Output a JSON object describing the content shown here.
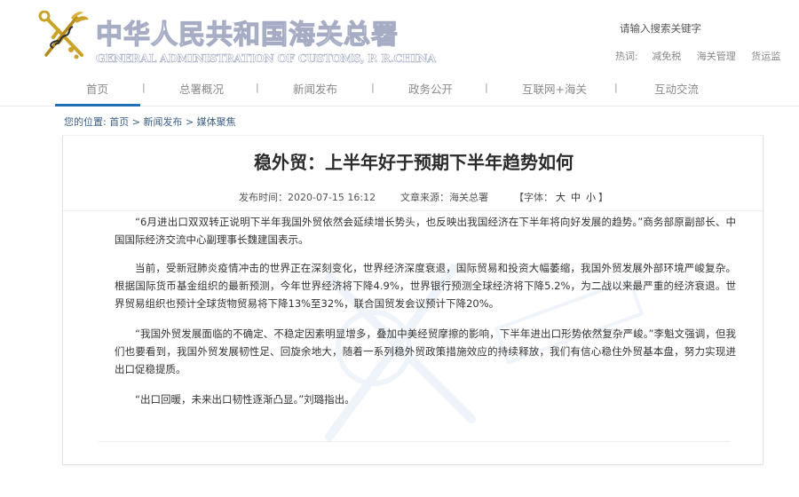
{
  "header": {
    "logo_cn": "中华人民共和国海关总署",
    "logo_en": "GENERAL ADMINISTRATION OF CUSTOMS, P. R.CHINA",
    "search_placeholder": "请输入搜索关键字",
    "hot_label": "热词:",
    "hot_words": [
      "减免税",
      "海关管理",
      "货运监"
    ]
  },
  "nav": {
    "items": [
      {
        "label": "首页",
        "active": true
      },
      {
        "label": "总署概况"
      },
      {
        "label": "新闻发布"
      },
      {
        "label": "政务公开"
      },
      {
        "label": "互联网+海关"
      },
      {
        "label": "互动交流"
      }
    ],
    "separator": "|"
  },
  "breadcrumb": {
    "prefix": "您的位置:",
    "items": [
      "首页",
      "新闻发布",
      "媒体聚焦"
    ],
    "sep": ">"
  },
  "article": {
    "title": "稳外贸：上半年好于预期下半年趋势如何",
    "publish_label": "发布时间：",
    "publish_time": "2020-07-15 16:12",
    "source_label": "文章来源：",
    "source": "海关总署",
    "font_label": "【字体：",
    "font_sizes": [
      "大",
      "中",
      "小"
    ],
    "font_close": "】",
    "paragraphs": [
      "“6月进出口双双转正说明下半年我国外贸依然会延续增长势头，也反映出我国经济在下半年将向好发展的趋势。”商务部原副部长、中国国际经济交流中心副理事长魏建国表示。",
      "当前，受新冠肺炎疫情冲击的世界正在深刻变化，世界经济深度衰退，国际贸易和投资大幅萎缩，我国外贸发展外部环境严峻复杂。根据国际货币基金组织的最新预测，今年世界经济将下降4.9%，世界银行预测全球经济将下降5.2%，为二战以来最严重的经济衰退。世界贸易组织也预计全球货物贸易将下降13%至32%，联合国贸发会议预计下降20%。",
      "“我国外贸发展面临的不确定、不稳定因素明显增多，叠加中美经贸摩擦的影响，下半年进出口形势依然复杂严峻。”李魁文强调，但我们也要看到，我国外贸发展韧性足、回旋余地大，随着一系列稳外贸政策措施效应的持续释放，我们有信心稳住外贸基本盘，努力实现进出口促稳提质。",
      "“出口回暖，未来出口韧性逐渐凸显。”刘璐指出。"
    ]
  },
  "colors": {
    "accent": "#1f6fb5",
    "logo_gold": "#c9a227",
    "logo_outline": "#a5acc4",
    "link": "#3c5f86"
  },
  "icons": [
    "customs-emblem-icon",
    "search-icon"
  ]
}
